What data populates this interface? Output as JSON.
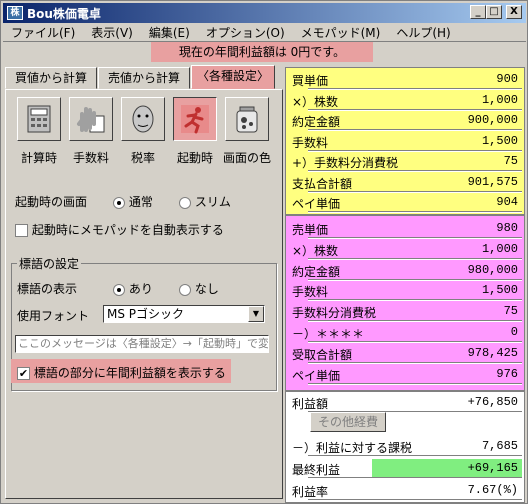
{
  "window": {
    "title": "Bou株価電卓",
    "min": "_",
    "max": "□",
    "close": "X"
  },
  "menu": [
    "ファイル(F)",
    "表示(V)",
    "編集(E)",
    "オプション(O)",
    "メモパッド(M)",
    "ヘルプ(H)"
  ],
  "banner": "現在の年間利益額は 0円です。",
  "tabs": [
    "買値から計算",
    "売値から計算",
    "〈各種設定〉"
  ],
  "icon_buttons": [
    {
      "label": "計算時",
      "icon": "calculator-icon"
    },
    {
      "label": "手数料",
      "icon": "hand-icon"
    },
    {
      "label": "税率",
      "icon": "face-icon"
    },
    {
      "label": "起動時",
      "icon": "runner-icon"
    },
    {
      "label": "画面の色",
      "icon": "paint-jar-icon"
    }
  ],
  "startup": {
    "label": "起動時の画面",
    "opt_normal": "通常",
    "opt_slim": "スリム",
    "memo_check": "起動時にメモパッドを自動表示する"
  },
  "motto": {
    "group_title": "標語の設定",
    "display_label": "標語の表示",
    "opt_on": "あり",
    "opt_off": "なし",
    "font_label": "使用フォント",
    "font_value": "MS Pゴシック",
    "message": "ここのメッセージは〈各種設定〉→「起動時」で変更",
    "profit_check": "標語の部分に年間利益額を表示する"
  },
  "colors": {
    "yellow": "#ffff80",
    "magenta": "#ff99ff",
    "pink": "#e8a0a0",
    "green": "#80ee80"
  },
  "buy": [
    {
      "k": "買単価",
      "v": "900"
    },
    {
      "k": "×）株数",
      "v": "1,000"
    },
    {
      "k": "約定金額",
      "v": "900,000"
    },
    {
      "k": "手数料",
      "v": "1,500"
    },
    {
      "k": "+）手数料分消費税",
      "v": "75"
    },
    {
      "k": "支払合計額",
      "v": "901,575"
    },
    {
      "k": "ペイ単価",
      "v": "904"
    }
  ],
  "sell": [
    {
      "k": "売単価",
      "v": "980"
    },
    {
      "k": "×）株数",
      "v": "1,000"
    },
    {
      "k": "約定金額",
      "v": "980,000"
    },
    {
      "k": "手数料",
      "v": "1,500"
    },
    {
      "k": "手数料分消費税",
      "v": "75"
    },
    {
      "k": "－）＊＊＊＊",
      "v": "0"
    },
    {
      "k": "受取合計額",
      "v": "978,425"
    },
    {
      "k": "ペイ単価",
      "v": "976"
    }
  ],
  "result": {
    "profit_k": "利益額",
    "profit_v": "+76,850",
    "other_btn": "その他経費",
    "tax_k": "－）利益に対する課税",
    "tax_v": "7,685",
    "final_k": "最終利益",
    "final_v": "+69,165",
    "rate_k": "利益率",
    "rate_v": "7.67(%)"
  }
}
